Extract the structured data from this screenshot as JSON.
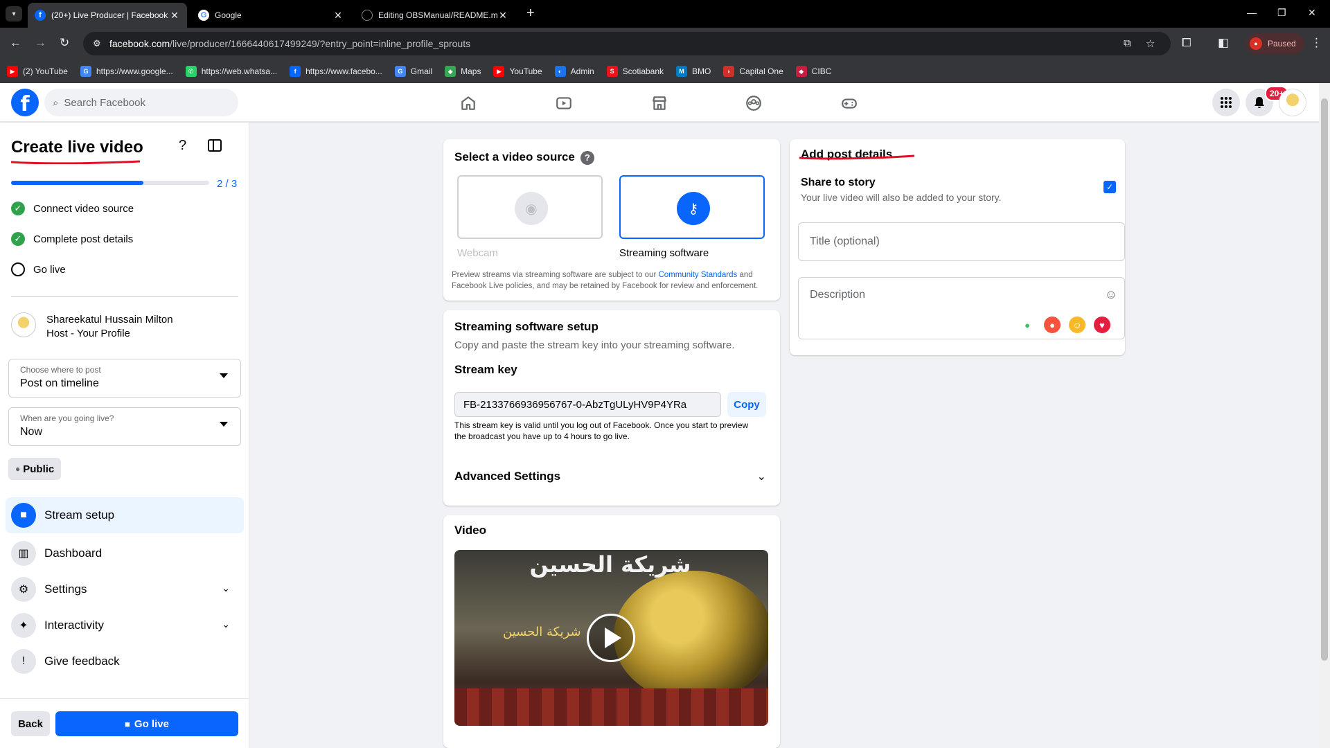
{
  "browser": {
    "tabs": [
      {
        "title": "(20+) Live Producer | Facebook",
        "active": true
      },
      {
        "title": "Google",
        "active": false
      },
      {
        "title": "Editing OBSManual/README.m",
        "active": false
      }
    ],
    "url_host": "facebook.com",
    "url_path": "/live/producer/1666440617499249/?entry_point=inline_profile_sprouts",
    "profile_status": "Paused",
    "bookmarks": [
      {
        "label": "(2) YouTube",
        "icon": "youtube-icon",
        "color": "#ff0000"
      },
      {
        "label": "https://www.google...",
        "icon": "google-icon",
        "color": "#4285f4"
      },
      {
        "label": "https://web.whatsa...",
        "icon": "whatsapp-icon",
        "color": "#25d366"
      },
      {
        "label": "https://www.facebo...",
        "icon": "facebook-icon",
        "color": "#0866ff"
      },
      {
        "label": "Gmail",
        "icon": "google-icon",
        "color": "#4285f4"
      },
      {
        "label": "Maps",
        "icon": "maps-icon",
        "color": "#34a853"
      },
      {
        "label": "YouTube",
        "icon": "youtube-icon",
        "color": "#ff0000"
      },
      {
        "label": "Admin",
        "icon": "admin-icon",
        "color": "#1a73e8"
      },
      {
        "label": "Scotiabank",
        "icon": "scotiabank-icon",
        "color": "#ec111a"
      },
      {
        "label": "BMO",
        "icon": "bmo-icon",
        "color": "#0079c1"
      },
      {
        "label": "Capital One",
        "icon": "capital-one-icon",
        "color": "#d03027"
      },
      {
        "label": "CIBC",
        "icon": "cibc-icon",
        "color": "#c41f3e"
      }
    ]
  },
  "header": {
    "search_placeholder": "Search Facebook",
    "notification_badge": "20+",
    "brand_color": "#0866ff"
  },
  "sidebar": {
    "title": "Create live video",
    "progress_label": "2 / 3",
    "progress_fraction": 0.667,
    "steps": [
      {
        "label": "Connect video source",
        "done": true
      },
      {
        "label": "Complete post details",
        "done": true
      },
      {
        "label": "Go live",
        "done": false
      }
    ],
    "host_name": "Shareekatul Hussain Milton",
    "host_role": "Host - Your Profile",
    "where_label": "Choose where to post",
    "where_value": "Post on timeline",
    "when_label": "When are you going live?",
    "when_value": "Now",
    "audience": "Public",
    "nav": [
      {
        "label": "Stream setup",
        "icon": "camera-icon",
        "active": true
      },
      {
        "label": "Dashboard",
        "icon": "dashboard-icon",
        "active": false
      },
      {
        "label": "Settings",
        "icon": "gear-icon",
        "active": false
      },
      {
        "label": "Interactivity",
        "icon": "sparkle-icon",
        "active": false
      },
      {
        "label": "Give feedback",
        "icon": "feedback-icon",
        "active": false
      }
    ],
    "back_label": "Back",
    "golive_label": "Go live"
  },
  "source_card": {
    "title": "Select a video source",
    "webcam_label": "Webcam",
    "software_label": "Streaming software",
    "note_pre": "Preview streams via streaming software are subject to our ",
    "note_link": "Community Standards",
    "note_post": " and Facebook Live policies, and may be retained by Facebook for review and enforcement."
  },
  "setup_card": {
    "title": "Streaming software setup",
    "subtitle": "Copy and paste the stream key into your streaming software.",
    "key_label": "Stream key",
    "key_value": "FB-2133766936956767-0-AbzTgULyHV9P4YRa",
    "copy_label": "Copy",
    "key_note": "This stream key is valid until you log out of Facebook. Once you start to preview the broadcast you have up to 4 hours to go live.",
    "advanced_label": "Advanced Settings"
  },
  "video_card": {
    "title": "Video"
  },
  "details_card": {
    "title": "Add post details",
    "story_title": "Share to story",
    "story_sub": "Your live video will also be added to your story.",
    "story_checked": true,
    "title_placeholder": "Title (optional)",
    "description_placeholder": "Description"
  }
}
